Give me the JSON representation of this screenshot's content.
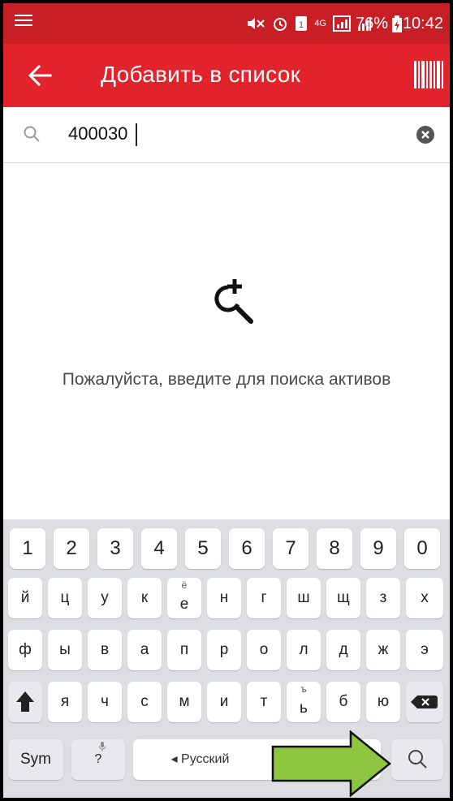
{
  "status_bar": {
    "battery": "76%",
    "time": "10:42",
    "network": "4G"
  },
  "toolbar": {
    "title": "Добавить в список",
    "back_icon": "arrow-left-icon",
    "barcode_icon": "barcode-icon"
  },
  "search": {
    "value": "400030",
    "search_icon": "search-icon",
    "clear_icon": "clear-icon"
  },
  "empty_state": {
    "icon": "search-plus-icon",
    "message": "Пожалуйста, введите для поиска активов"
  },
  "keyboard": {
    "row_numbers": [
      "1",
      "2",
      "3",
      "4",
      "5",
      "6",
      "7",
      "8",
      "9",
      "0"
    ],
    "row1": [
      "й",
      "ц",
      "у",
      "к",
      "е",
      "н",
      "г",
      "ш",
      "щ",
      "з",
      "х"
    ],
    "row1_alt_e": "ё",
    "row2": [
      "ф",
      "ы",
      "в",
      "а",
      "п",
      "р",
      "о",
      "л",
      "д",
      "ж",
      "э"
    ],
    "row3": [
      "я",
      "ч",
      "с",
      "м",
      "и",
      "т",
      "ь",
      "б",
      "ю"
    ],
    "row3_alt_soft": "ъ",
    "sym_label": "Sym",
    "question_label": "?",
    "language_label": "◂ Русский",
    "colors": {
      "keyboard_bg": "#dddee2",
      "toolbar": "#e3232c",
      "status_bar": "#c81e25",
      "arrow": "#8cc63f"
    }
  }
}
